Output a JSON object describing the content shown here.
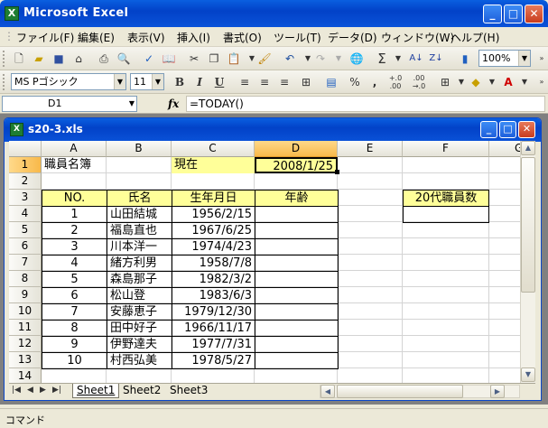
{
  "app": {
    "title": "Microsoft Excel"
  },
  "caption": {
    "minimize": "_",
    "maximize": "□",
    "close": "✕"
  },
  "menu": [
    "ファイル(F)",
    "編集(E)",
    "表示(V)",
    "挿入(I)",
    "書式(O)",
    "ツール(T)",
    "データ(D)",
    "ウィンドウ(W)",
    "ヘルプ(H)"
  ],
  "toolbar": {
    "zoom": "100%"
  },
  "format_toolbar": {
    "font": "MS Pゴシック",
    "size": "11",
    "bold": "B",
    "italic": "I",
    "underline": "U",
    "percent": "%",
    "comma": ",",
    "inc_decimal": "+.0 .00",
    "dec_decimal": ".00 →.0"
  },
  "formula_bar": {
    "name_box": "D1",
    "fx": "fx",
    "formula": "=TODAY()"
  },
  "workbook": {
    "title": "s20-3.xls"
  },
  "sheet": {
    "columns": [
      "A",
      "B",
      "C",
      "D",
      "E",
      "F",
      "G"
    ],
    "rows": [
      "1",
      "2",
      "3",
      "4",
      "5",
      "6",
      "7",
      "8",
      "9",
      "10",
      "11",
      "12",
      "13",
      "14"
    ],
    "row1": {
      "a": "職員名簿",
      "c": "現在",
      "d": "2008/1/25"
    },
    "headers": {
      "no": "NO.",
      "name": "氏名",
      "birth": "生年月日",
      "age": "年齢",
      "count": "20代職員数"
    },
    "staff": [
      {
        "no": "1",
        "name": "山田結城",
        "birth": "1956/2/15"
      },
      {
        "no": "2",
        "name": "福島直也",
        "birth": "1967/6/25"
      },
      {
        "no": "3",
        "name": "川本洋一",
        "birth": "1974/4/23"
      },
      {
        "no": "4",
        "name": "緒方利男",
        "birth": "1958/7/8"
      },
      {
        "no": "5",
        "name": "森島那子",
        "birth": "1982/3/2"
      },
      {
        "no": "6",
        "name": "松山登",
        "birth": "1983/6/3"
      },
      {
        "no": "7",
        "name": "安藤恵子",
        "birth": "1979/12/30"
      },
      {
        "no": "8",
        "name": "田中好子",
        "birth": "1966/11/17"
      },
      {
        "no": "9",
        "name": "伊野達夫",
        "birth": "1977/7/31"
      },
      {
        "no": "10",
        "name": "村西弘美",
        "birth": "1978/5/27"
      }
    ]
  },
  "tabs": [
    "Sheet1",
    "Sheet2",
    "Sheet3"
  ],
  "status": "コマンド",
  "colors": {
    "title_blue": "#0a52d8",
    "header_yellow": "#ffff99",
    "selection_orange": "#f8b94a"
  }
}
